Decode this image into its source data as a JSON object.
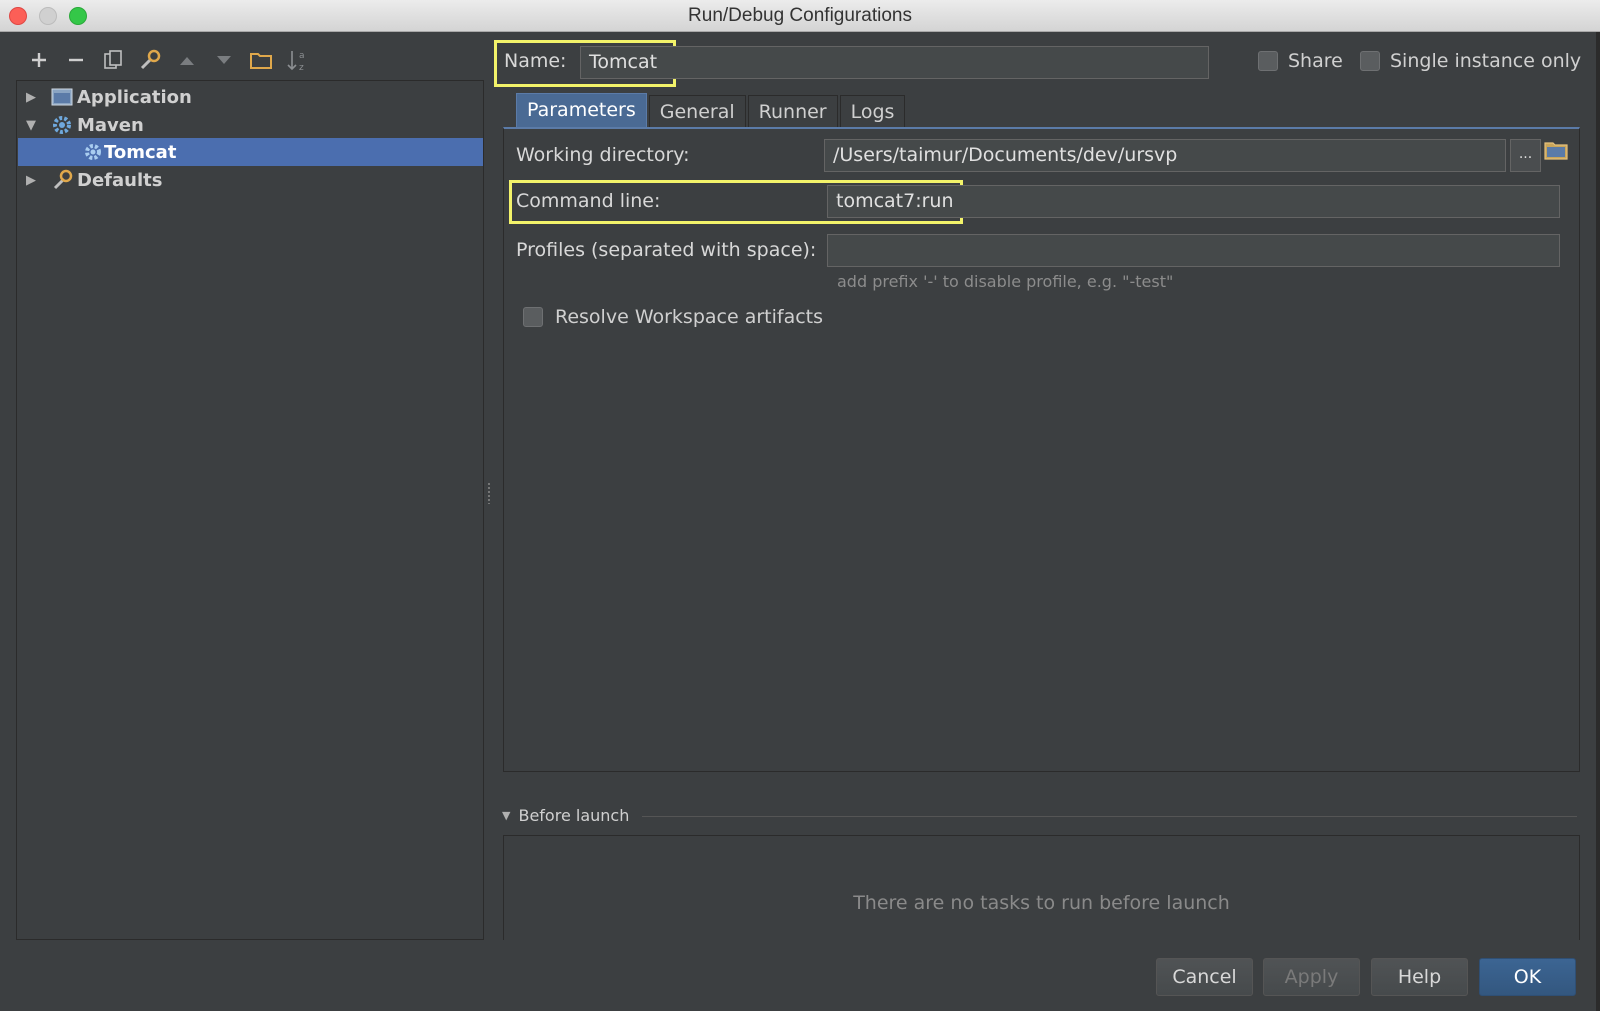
{
  "window": {
    "title": "Run/Debug Configurations"
  },
  "toolbar": {
    "buttons": [
      "add-icon",
      "remove-icon",
      "copy-icon",
      "edit-defaults-icon",
      "move-up-icon",
      "move-down-icon",
      "folder-icon",
      "sort-icon"
    ]
  },
  "tree": {
    "items": [
      {
        "label": "Application",
        "icon": "application-icon",
        "expanded": false
      },
      {
        "label": "Maven",
        "icon": "maven-gear-icon",
        "expanded": true
      },
      {
        "label": "Tomcat",
        "icon": "maven-gear-icon",
        "selected": true
      },
      {
        "label": "Defaults",
        "icon": "defaults-wrench-icon",
        "expanded": false
      }
    ]
  },
  "config": {
    "name_label": "Name:",
    "name_value": "Tomcat",
    "share_label": "Share",
    "single_instance_label": "Single instance only"
  },
  "tabs": [
    {
      "label": "Parameters",
      "active": true
    },
    {
      "label": "General"
    },
    {
      "label": "Runner"
    },
    {
      "label": "Logs"
    }
  ],
  "parameters": {
    "working_dir_label": "Working directory:",
    "working_dir_value": "/Users/taimur/Documents/dev/ursvp",
    "browse_label": "...",
    "command_line_label": "Command line:",
    "command_line_value": "tomcat7:run",
    "profiles_label": "Profiles (separated with space):",
    "profiles_value": "",
    "profiles_hint": "add prefix '-' to disable profile, e.g. \"-test\"",
    "resolve_label": "Resolve Workspace artifacts"
  },
  "before_launch": {
    "header": "Before launch",
    "empty_text": "There are no tasks to run before launch"
  },
  "buttons": {
    "cancel": "Cancel",
    "apply": "Apply",
    "help": "Help",
    "ok": "OK"
  },
  "colors": {
    "background": "#3c3f41",
    "selection": "#4b6eaf",
    "highlight": "#f3f36a"
  }
}
